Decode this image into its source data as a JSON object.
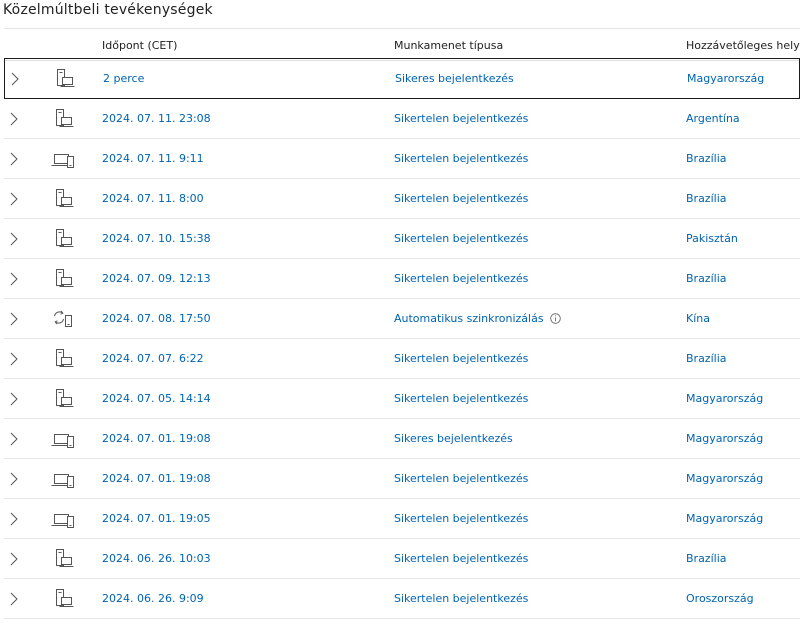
{
  "title": "Közelmúltbeli tevékenységek",
  "columns": {
    "time": "Időpont (CET)",
    "type": "Munkamenet típusa",
    "location": "Hozzávetőleges hely"
  },
  "accent": "#0063b1",
  "rows": [
    {
      "device": "desktop-icon",
      "time": "2 perce",
      "type": "Sikeres bejelentkezés",
      "location": "Magyarország",
      "selected": true
    },
    {
      "device": "desktop-icon",
      "time": "2024. 07. 11. 23:08",
      "type": "Sikertelen bejelentkezés",
      "location": "Argentína"
    },
    {
      "device": "laptop-phone-icon",
      "time": "2024. 07. 11. 9:11",
      "type": "Sikertelen bejelentkezés",
      "location": "Brazília"
    },
    {
      "device": "desktop-icon",
      "time": "2024. 07. 11. 8:00",
      "type": "Sikertelen bejelentkezés",
      "location": "Brazília"
    },
    {
      "device": "desktop-icon",
      "time": "2024. 07. 10. 15:38",
      "type": "Sikertelen bejelentkezés",
      "location": "Pakisztán"
    },
    {
      "device": "desktop-icon",
      "time": "2024. 07. 09. 12:13",
      "type": "Sikertelen bejelentkezés",
      "location": "Brazília"
    },
    {
      "device": "sync-icon",
      "time": "2024. 07. 08. 17:50",
      "type": "Automatikus szinkronizálás",
      "location": "Kína",
      "info": true
    },
    {
      "device": "desktop-icon",
      "time": "2024. 07. 07. 6:22",
      "type": "Sikertelen bejelentkezés",
      "location": "Brazília"
    },
    {
      "device": "desktop-icon",
      "time": "2024. 07. 05. 14:14",
      "type": "Sikertelen bejelentkezés",
      "location": "Magyarország"
    },
    {
      "device": "laptop-phone-icon",
      "time": "2024. 07. 01. 19:08",
      "type": "Sikeres bejelentkezés",
      "location": "Magyarország"
    },
    {
      "device": "laptop-phone-icon",
      "time": "2024. 07. 01. 19:08",
      "type": "Sikertelen bejelentkezés",
      "location": "Magyarország"
    },
    {
      "device": "laptop-phone-icon",
      "time": "2024. 07. 01. 19:05",
      "type": "Sikertelen bejelentkezés",
      "location": "Magyarország"
    },
    {
      "device": "desktop-icon",
      "time": "2024. 06. 26. 10:03",
      "type": "Sikertelen bejelentkezés",
      "location": "Brazília"
    },
    {
      "device": "desktop-icon",
      "time": "2024. 06. 26. 9:09",
      "type": "Sikertelen bejelentkezés",
      "location": "Oroszország"
    }
  ]
}
